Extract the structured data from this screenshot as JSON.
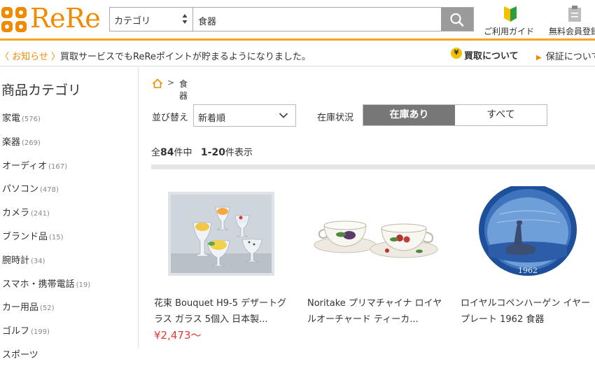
{
  "brand": {
    "logo_text": "ReRe",
    "color": "#f08a00"
  },
  "search": {
    "category_value": "カテゴリ",
    "query": "食器"
  },
  "header_links": {
    "guide": "ご利用ガイド",
    "member": "無料会員登録"
  },
  "notice": {
    "link": "〈 お知らせ 〉",
    "text": "買取サービスでもReReポイントが貯まるようになりました。",
    "kaitori": "買取について",
    "yen": "¥",
    "hosho": "保証について"
  },
  "sidebar": {
    "title": "商品カテゴリ",
    "items": [
      {
        "label": "家電",
        "count": "(576)"
      },
      {
        "label": "楽器",
        "count": "(269)"
      },
      {
        "label": "オーディオ",
        "count": "(167)"
      },
      {
        "label": "パソコン",
        "count": "(478)"
      },
      {
        "label": "カメラ",
        "count": "(241)"
      },
      {
        "label": "ブランド品",
        "count": "(15)"
      },
      {
        "label": "腕時計",
        "count": "(34)"
      },
      {
        "label": "スマホ・携帯電話",
        "count": "(19)"
      },
      {
        "label": "カー用品",
        "count": "(52)"
      },
      {
        "label": "ゴルフ",
        "count": "(199)"
      },
      {
        "label": "スポーツ",
        "count": ""
      }
    ]
  },
  "breadcrumb": {
    "separator": ">",
    "current": "食器"
  },
  "filters": {
    "sort_label": "並び替え",
    "sort_value": "新着順",
    "stock_label": "在庫状況",
    "stock_on": "在庫あり",
    "stock_all": "すべて"
  },
  "results": {
    "prefix": "全",
    "total": "84",
    "mid": "件中",
    "range": "1-20",
    "suffix": "件表示"
  },
  "products": [
    {
      "name": "花束 Bouquet H9-5 デザートグラス ガラス 5個入 日本製...",
      "price": "¥2,473〜"
    },
    {
      "name": "Noritake プリマチャイナ ロイヤルオーチャード ティーカ...",
      "price": ""
    },
    {
      "name": "ロイヤルコペンハーゲン イヤープレート 1962 食器",
      "price": ""
    }
  ],
  "product_images": {
    "plate_year": "1962"
  }
}
